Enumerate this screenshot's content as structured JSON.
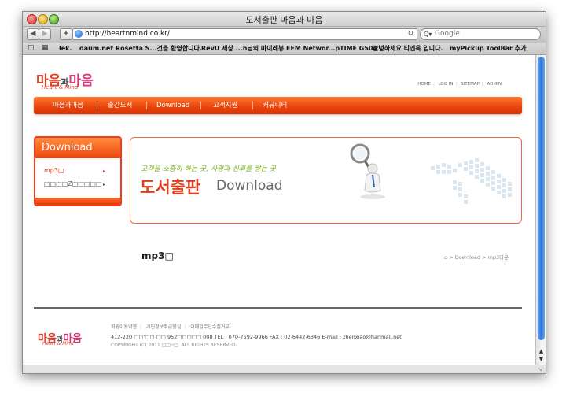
{
  "window": {
    "title": "도서출판 마음과 마음",
    "url": "http://heartnmind.co.kr/",
    "search_placeholder": "Google",
    "back_glyph": "◀",
    "forward_glyph": "▶",
    "add_glyph": "+",
    "reload_glyph": "↻",
    "search_glyph": "Q▾",
    "bookmarks": [
      "lek.",
      "daum.net",
      "Rosetta S...것을 환영합니다.",
      "RevU 세상 ...h님의 마이레뷰",
      "EFM Networ...pTIME G504",
      "안녕하세요 티엔옥 입니다.",
      "myPickup ToolBar 추가"
    ]
  },
  "logo": {
    "part1": "마음",
    "part2": "과",
    "part3": "마음",
    "sub": "Heart & Mind"
  },
  "util_links": [
    "HOME",
    "LOG IN",
    "SITEMAP",
    "ADMIN"
  ],
  "gnb": [
    "마음과마음",
    "출간도서",
    "Download",
    "고객지원",
    "커뮤니티"
  ],
  "lnb": {
    "title": "Download",
    "items": [
      {
        "label": "mp3□",
        "arrow": "▸",
        "active": true
      },
      {
        "label": "□□□□Z□□□□□",
        "arrow": "▸",
        "active": false
      }
    ]
  },
  "banner": {
    "tagline": "고객을 소중히 하는 곳, 사랑과 신뢰를 쌓는 곳",
    "title": "도서출판",
    "subtitle": "Download"
  },
  "content": {
    "title": "mp3□",
    "breadcrumb": "⌂ > Download > mp3다운"
  },
  "footer": {
    "links": [
      "회원이용약관",
      "개인정보취급방침",
      "이메일무단수집거부"
    ],
    "address": "412-220 □□'□□ □□ 952□□□□□  008    TEL : 070-7592-9966    FAX : 02-6442-6346    E-mail : zhenxiao@hanmail.net",
    "copyright": "COPYRIGHT (C) 2011 □□▫□. ALL RIGHTS RESERVED."
  },
  "colors": {
    "accent": "#e8420b",
    "logo_red": "#e0422b",
    "logo_pink": "#d33a7a",
    "tagline_green": "#7ab51d"
  }
}
